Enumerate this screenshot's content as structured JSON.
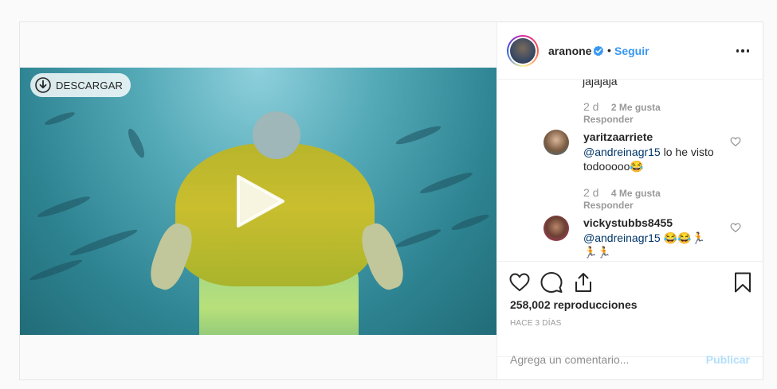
{
  "video": {
    "download_label": "DESCARGAR"
  },
  "header": {
    "username": "aranone",
    "separator": "•",
    "follow_label": "Seguir"
  },
  "comments": {
    "cut_text": "jajajaja",
    "items": [
      {
        "time": "2 d",
        "likes": "2 Me gusta",
        "reply": "Responder",
        "username": "yaritzaarriete",
        "mention": "@andreinagr15",
        "text": " lo he visto todooooo😂"
      },
      {
        "time": "2 d",
        "likes": "4 Me gusta",
        "reply": "Responder",
        "username": "vickystubbs8455",
        "mention": "@andreinagr15",
        "text": " 😂😂🏃🏃🏃"
      }
    ]
  },
  "actions": {
    "views": "258,002 reproducciones",
    "posted": "HACE 3 DÍAS"
  },
  "add_comment": {
    "placeholder": "Agrega un comentario...",
    "publish_label": "Publicar"
  },
  "colors": {
    "accent": "#3897f0",
    "muted": "#999999",
    "publish_disabled": "#b2dffc",
    "mention": "#003569"
  }
}
